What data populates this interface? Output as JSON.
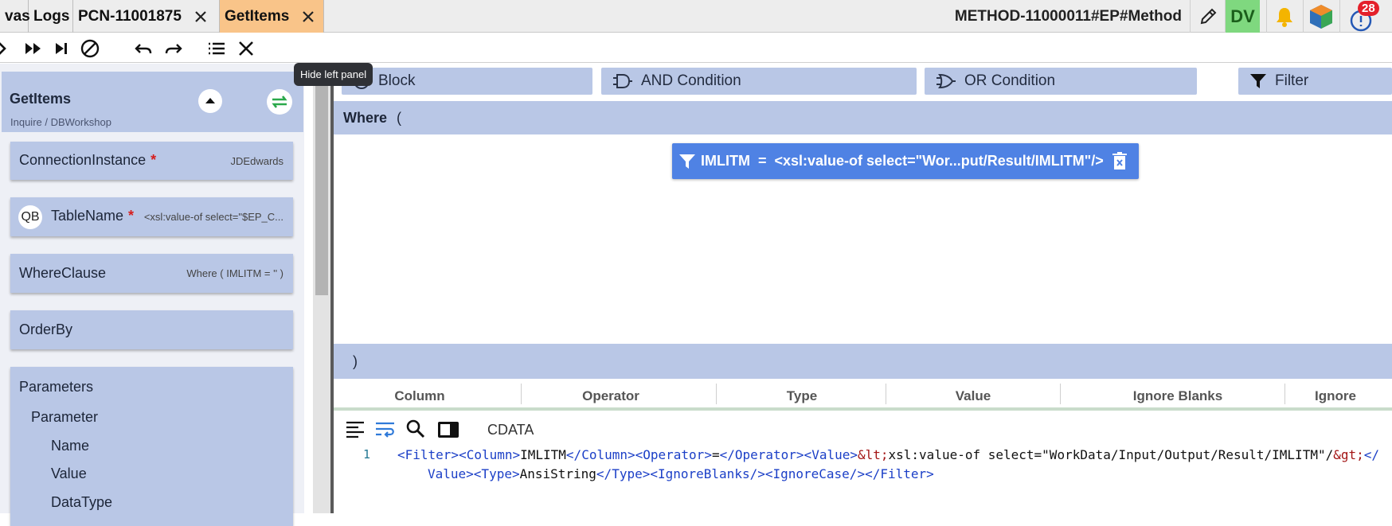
{
  "tabs": [
    {
      "label": "vas",
      "closable": false,
      "active": false
    },
    {
      "label": "Logs",
      "closable": false,
      "active": false
    },
    {
      "label": "PCN-11001875",
      "closable": true,
      "active": false
    },
    {
      "label": "GetItems",
      "closable": true,
      "active": true
    }
  ],
  "header": {
    "method_title": "METHOD-11000011#EP#Method",
    "avatar_initials": "DV",
    "notification_count": "28"
  },
  "tooltip": {
    "text": "Hide left panel"
  },
  "left_panel": {
    "title": "GetItems",
    "subtitle": "Inquire / DBWorkshop",
    "cards": {
      "connection": {
        "label": "ConnectionInstance",
        "required": "*",
        "value": "JDEdwards"
      },
      "table": {
        "badge": "QB",
        "label": "TableName",
        "required": "*",
        "value": "<xsl:value-of select=\"$EP_C..."
      },
      "where": {
        "label": "WhereClause",
        "value": "Where ( IMLITM = '' )"
      },
      "orderby": {
        "label": "OrderBy"
      },
      "parameters": {
        "label": "Parameters",
        "child": "Parameter",
        "fields": [
          "Name",
          "Value",
          "DataType"
        ]
      }
    }
  },
  "conditions": {
    "block": "Block",
    "and": "AND Condition",
    "or": "OR Condition",
    "filter": "Filter"
  },
  "where": {
    "keyword": "Where",
    "open": "(",
    "close": ")"
  },
  "filter_chip": {
    "column": "IMLITM",
    "operator": "=",
    "value": "<xsl:value-of select=\"Wor...put/Result/IMLITM\"/>"
  },
  "grid": {
    "columns": [
      "Column",
      "Operator",
      "Type",
      "Value",
      "Ignore Blanks",
      "Ignore"
    ]
  },
  "editor": {
    "cdata_label": "CDATA",
    "line_number": "1"
  },
  "colors": {
    "panel_blue": "#b9c7e6",
    "chip_blue": "#4f82e4",
    "active_tab": "#f9c489",
    "avatar_green": "#7fd87f",
    "badge_red": "#e4202a"
  }
}
